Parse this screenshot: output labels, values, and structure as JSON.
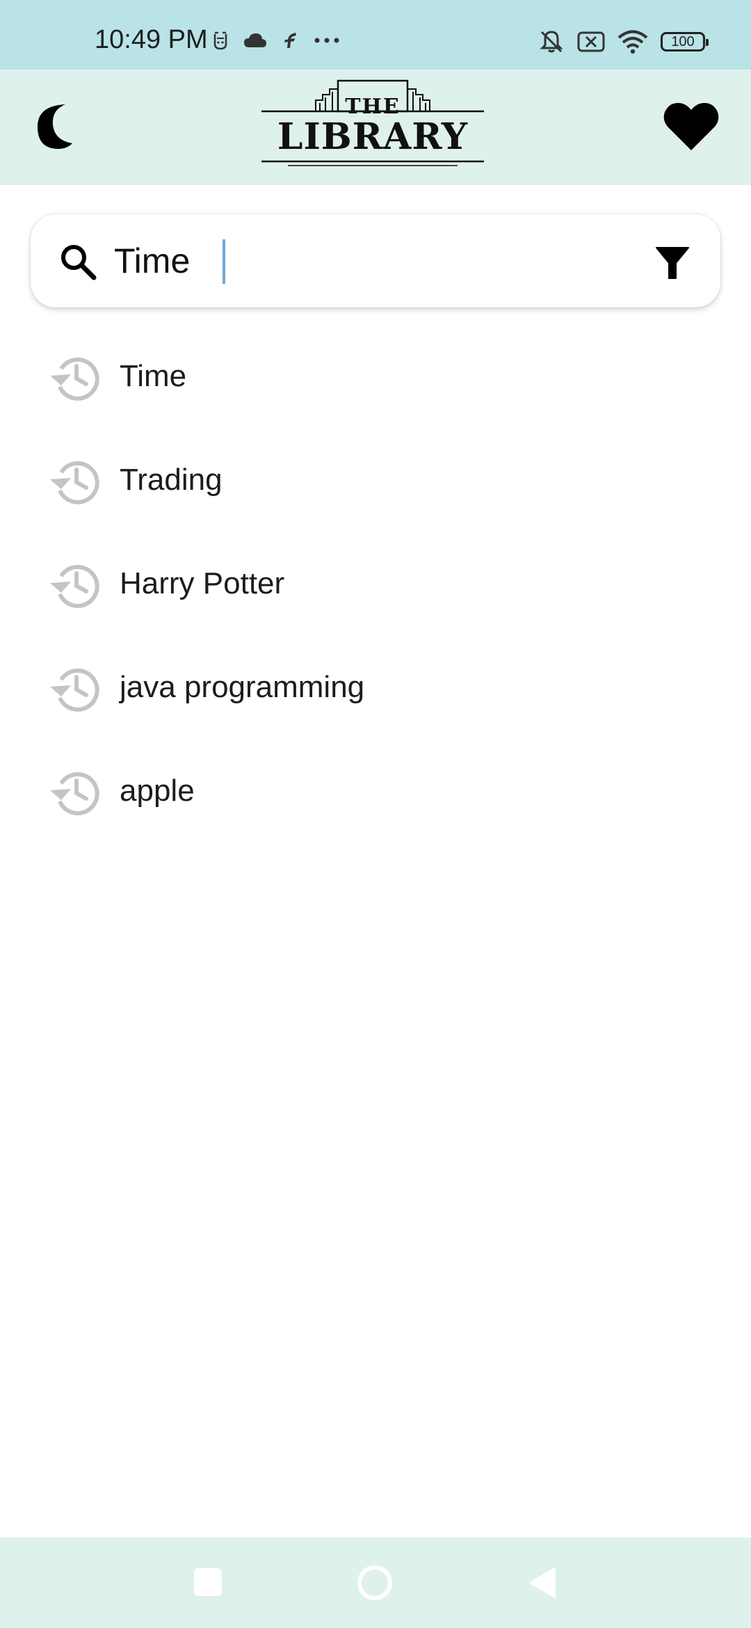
{
  "status_bar": {
    "time": "10:49 PM",
    "battery": "100",
    "left_icons": [
      "face-icon",
      "cloud-icon",
      "bolt-icon",
      "more-dots-icon"
    ],
    "right_icons": [
      "bell-off-icon",
      "no-sim-icon",
      "wifi-icon",
      "battery-icon"
    ]
  },
  "app_bar": {
    "logo_line1": "THE",
    "logo_line2": "LIBRARY",
    "left_icon": "moon-icon",
    "right_icon": "heart-icon"
  },
  "search": {
    "value": "Time",
    "icon": "search-icon",
    "filter_icon": "filter-icon"
  },
  "history": {
    "icon": "history-icon",
    "items": [
      {
        "label": "Time"
      },
      {
        "label": "Trading"
      },
      {
        "label": "Harry Potter"
      },
      {
        "label": "java programming"
      },
      {
        "label": "apple"
      }
    ]
  },
  "nav_bar": {
    "buttons": [
      "recent-apps-button",
      "home-button",
      "back-button"
    ]
  },
  "colors": {
    "status_bar_bg": "#b9e3e6",
    "app_bar_bg": "#dff1ec",
    "history_icon": "#c4c4c4",
    "caret": "#6fa7d9"
  }
}
